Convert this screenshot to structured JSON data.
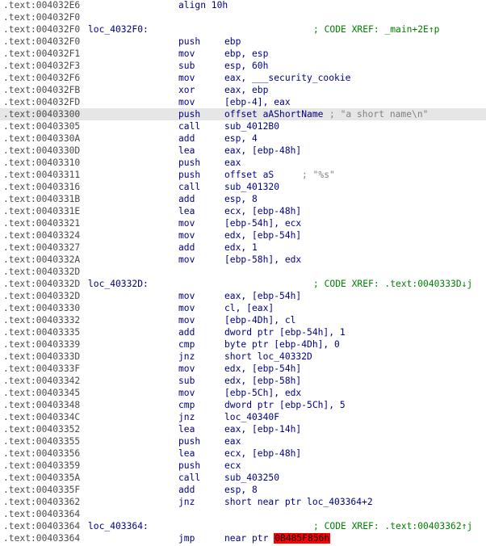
{
  "lines": [
    {
      "addr": ".text:004032E6",
      "mnem": "align 10h",
      "ops": ""
    },
    {
      "addr": ".text:004032F0"
    },
    {
      "addr": ".text:004032F0",
      "label": "loc_4032F0:",
      "xref": "; CODE XREF: _main+2E↑p"
    },
    {
      "addr": ".text:004032F0",
      "mnem": "push",
      "ops": "ebp"
    },
    {
      "addr": ".text:004032F1",
      "mnem": "mov",
      "ops": "ebp, esp"
    },
    {
      "addr": ".text:004032F3",
      "mnem": "sub",
      "ops": "esp, 60h"
    },
    {
      "addr": ".text:004032F6",
      "mnem": "mov",
      "ops": "eax, ___security_cookie"
    },
    {
      "addr": ".text:004032FB",
      "mnem": "xor",
      "ops": "eax, ebp"
    },
    {
      "addr": ".text:004032FD",
      "mnem": "mov",
      "ops": "[ebp-4], eax"
    },
    {
      "addr": ".text:00403300",
      "mnem": "push",
      "ops": "offset aAShortName",
      "comment": "; \"a short name\\n\"",
      "selected": true
    },
    {
      "addr": ".text:00403305",
      "mnem": "call",
      "ops": "sub_4012B0"
    },
    {
      "addr": ".text:0040330A",
      "mnem": "add",
      "ops": "esp, 4"
    },
    {
      "addr": ".text:0040330D",
      "mnem": "lea",
      "ops": "eax, [ebp-48h]"
    },
    {
      "addr": ".text:00403310",
      "mnem": "push",
      "ops": "eax"
    },
    {
      "addr": ".text:00403311",
      "mnem": "push",
      "ops": "offset aS",
      "comment": "; \"%s\""
    },
    {
      "addr": ".text:00403316",
      "mnem": "call",
      "ops": "sub_401320"
    },
    {
      "addr": ".text:0040331B",
      "mnem": "add",
      "ops": "esp, 8"
    },
    {
      "addr": ".text:0040331E",
      "mnem": "lea",
      "ops": "ecx, [ebp-48h]"
    },
    {
      "addr": ".text:00403321",
      "mnem": "mov",
      "ops": "[ebp-54h], ecx"
    },
    {
      "addr": ".text:00403324",
      "mnem": "mov",
      "ops": "edx, [ebp-54h]"
    },
    {
      "addr": ".text:00403327",
      "mnem": "add",
      "ops": "edx, 1"
    },
    {
      "addr": ".text:0040332A",
      "mnem": "mov",
      "ops": "[ebp-58h], edx"
    },
    {
      "addr": ".text:0040332D"
    },
    {
      "addr": ".text:0040332D",
      "label": "loc_40332D:",
      "xref": "; CODE XREF: .text:0040333D↓j"
    },
    {
      "addr": ".text:0040332D",
      "mnem": "mov",
      "ops": "eax, [ebp-54h]"
    },
    {
      "addr": ".text:00403330",
      "mnem": "mov",
      "ops": "cl, [eax]"
    },
    {
      "addr": ".text:00403332",
      "mnem": "mov",
      "ops": "[ebp-4Dh], cl"
    },
    {
      "addr": ".text:00403335",
      "mnem": "add",
      "ops": "dword ptr [ebp-54h], 1"
    },
    {
      "addr": ".text:00403339",
      "mnem": "cmp",
      "ops": "byte ptr [ebp-4Dh], 0"
    },
    {
      "addr": ".text:0040333D",
      "mnem": "jnz",
      "ops": "short loc_40332D"
    },
    {
      "addr": ".text:0040333F",
      "mnem": "mov",
      "ops": "edx, [ebp-54h]"
    },
    {
      "addr": ".text:00403342",
      "mnem": "sub",
      "ops": "edx, [ebp-58h]"
    },
    {
      "addr": ".text:00403345",
      "mnem": "mov",
      "ops": "[ebp-5Ch], edx"
    },
    {
      "addr": ".text:00403348",
      "mnem": "cmp",
      "ops": "dword ptr [ebp-5Ch], 5"
    },
    {
      "addr": ".text:0040334C",
      "mnem": "jnz",
      "ops": "loc_40340F"
    },
    {
      "addr": ".text:00403352",
      "mnem": "lea",
      "ops": "eax, [ebp-14h]"
    },
    {
      "addr": ".text:00403355",
      "mnem": "push",
      "ops": "eax"
    },
    {
      "addr": ".text:00403356",
      "mnem": "lea",
      "ops": "ecx, [ebp-48h]"
    },
    {
      "addr": ".text:00403359",
      "mnem": "push",
      "ops": "ecx"
    },
    {
      "addr": ".text:0040335A",
      "mnem": "call",
      "ops": "sub_403250"
    },
    {
      "addr": ".text:0040335F",
      "mnem": "add",
      "ops": "esp, 8"
    },
    {
      "addr": ".text:00403362",
      "mnem": "jnz",
      "ops": "short near ptr loc_403364+2"
    },
    {
      "addr": ".text:00403364"
    },
    {
      "addr": ".text:00403364",
      "label": "loc_403364:",
      "xref": "; CODE XREF: .text:00403362↑j"
    },
    {
      "addr": ".text:00403364",
      "mnem": "jmp",
      "ops": "near ptr ",
      "ops_error": "0B485F856h"
    }
  ]
}
